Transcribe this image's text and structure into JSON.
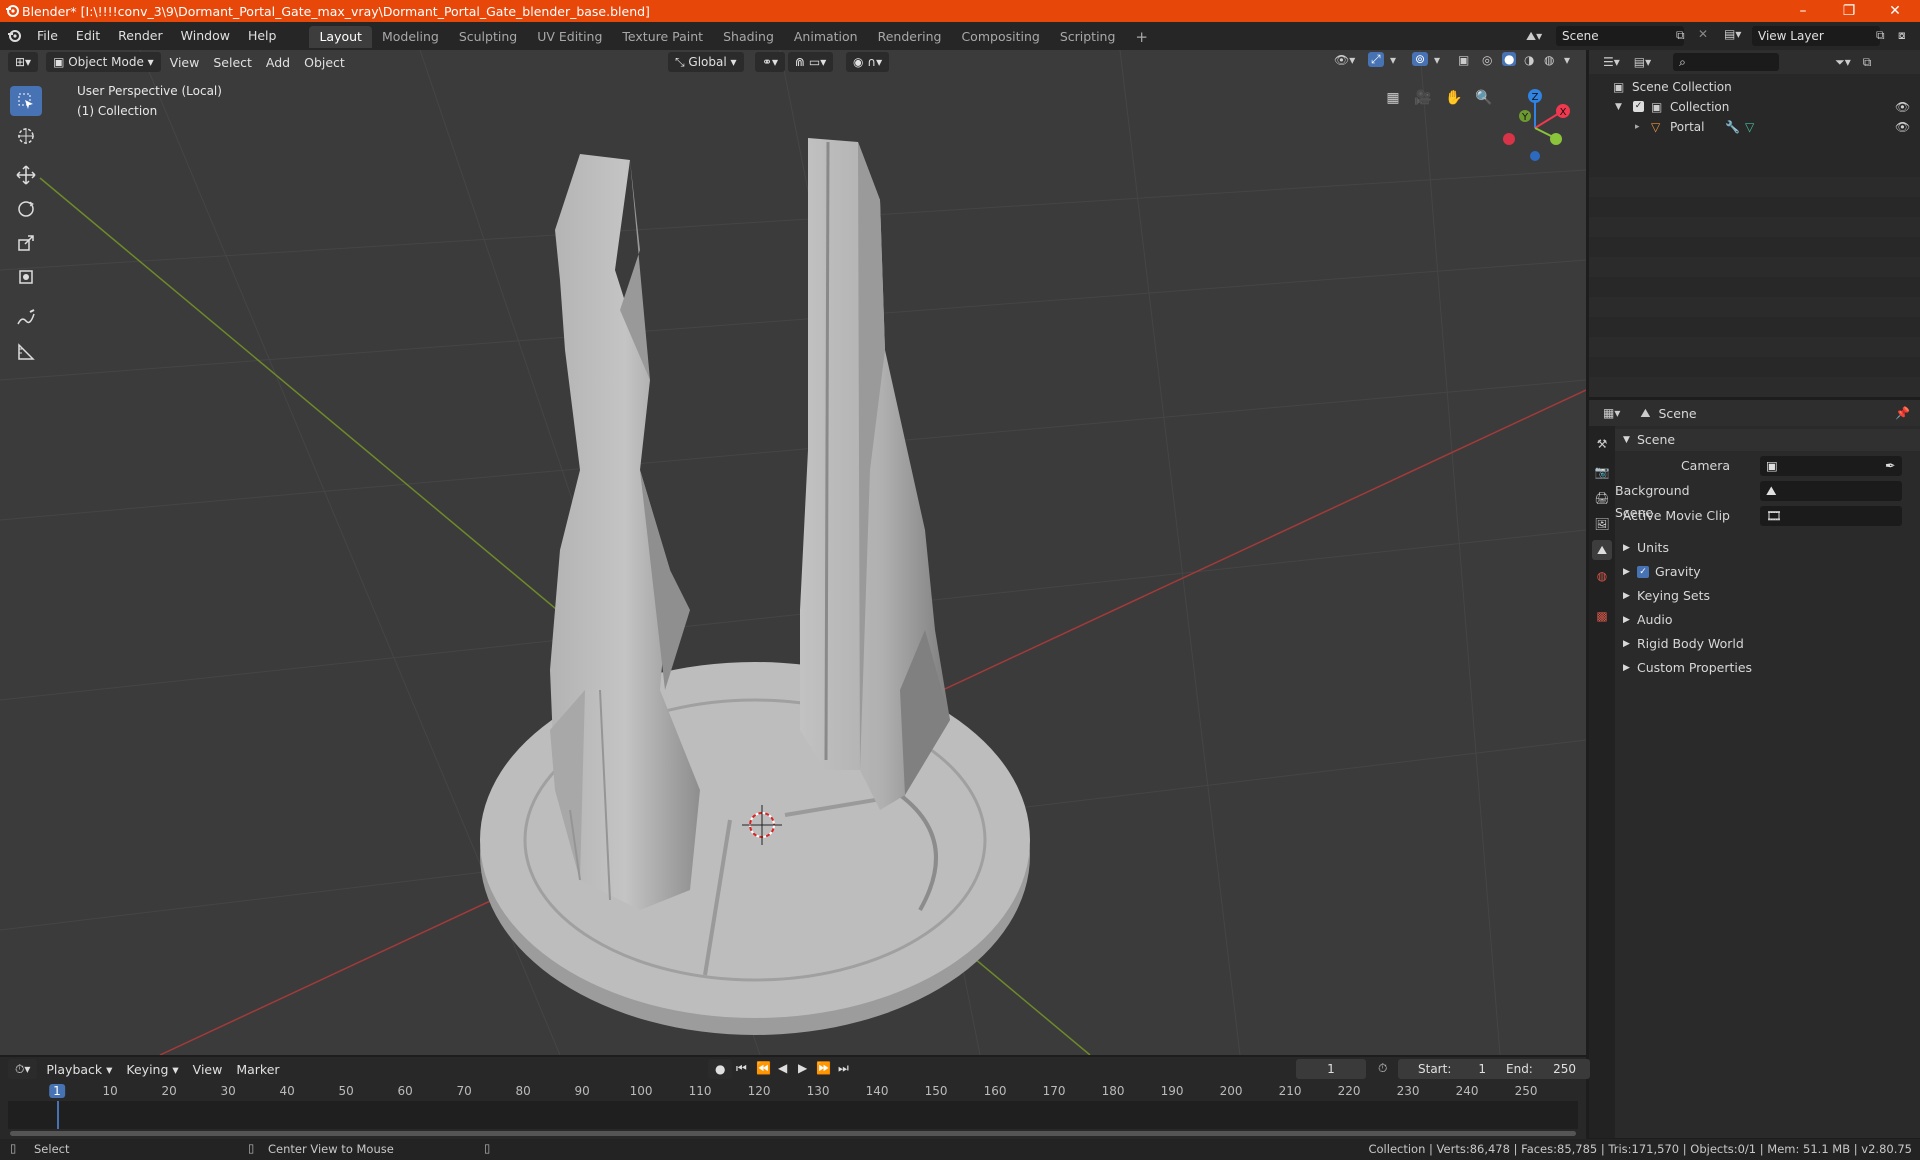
{
  "window": {
    "title": "Blender* [I:\\!!!!conv_3\\9\\Dormant_Portal_Gate_max_vray\\Dormant_Portal_Gate_blender_base.blend]",
    "minimize": "–",
    "restore": "❐",
    "close": "✕"
  },
  "menu": [
    "File",
    "Edit",
    "Render",
    "Window",
    "Help"
  ],
  "workspaces": [
    "Layout",
    "Modeling",
    "Sculpting",
    "UV Editing",
    "Texture Paint",
    "Shading",
    "Animation",
    "Rendering",
    "Compositing",
    "Scripting"
  ],
  "workspace_add": "+",
  "scene_field": "Scene",
  "view_layer_field": "View Layer",
  "viewport": {
    "mode": "Object Mode",
    "menus": [
      "View",
      "Select",
      "Add",
      "Object"
    ],
    "transform_orientation": "Global",
    "overlay_line1": "User Perspective (Local)",
    "overlay_line2": "(1) Collection",
    "gizmo": {
      "x": "X",
      "y": "Y",
      "z": "Z"
    }
  },
  "outliner": {
    "search_placeholder": "",
    "root": "Scene Collection",
    "collection": "Collection",
    "object": "Portal"
  },
  "properties": {
    "context": "Scene",
    "section": "Scene",
    "camera_label": "Camera",
    "background_scene_label": "Background Scene",
    "active_clip_label": "Active Movie Clip",
    "panels": [
      "Units",
      "Gravity",
      "Keying Sets",
      "Audio",
      "Rigid Body World",
      "Custom Properties"
    ],
    "gravity_checked": true
  },
  "timeline": {
    "menus": [
      "Playback",
      "Keying",
      "View",
      "Marker"
    ],
    "current_frame": "1",
    "start_label": "Start:",
    "start": "1",
    "end_label": "End:",
    "end": "250",
    "ruler": [
      "1",
      "10",
      "20",
      "30",
      "40",
      "50",
      "60",
      "70",
      "80",
      "90",
      "100",
      "110",
      "120",
      "130",
      "140",
      "150",
      "160",
      "170",
      "180",
      "190",
      "200",
      "210",
      "220",
      "230",
      "240",
      "250"
    ]
  },
  "status": {
    "select": "Select",
    "center_view": "Center View to Mouse",
    "stats": "Collection | Verts:86,478 | Faces:85,785 | Tris:171,570 | Objects:0/1 | Mem: 51.1 MB | v2.80.75"
  },
  "colors": {
    "titlebar": "#e8470a",
    "accent": "#4772b3",
    "viewport_bg": "#3b3b3b",
    "panel_bg": "#282828",
    "axis_x": "#f0384f",
    "axis_y": "#8bc33b",
    "axis_z": "#2f83e3"
  }
}
